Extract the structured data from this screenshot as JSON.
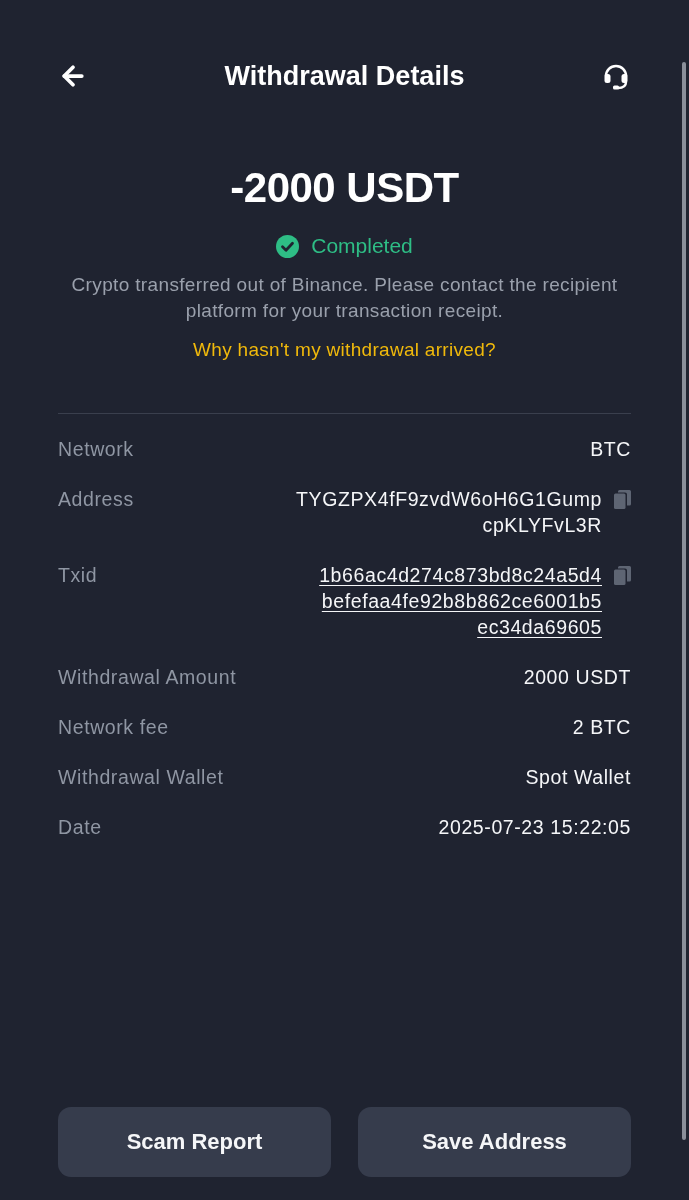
{
  "header": {
    "title": "Withdrawal Details"
  },
  "summary": {
    "amount": "-2000 USDT",
    "status": {
      "label": "Completed",
      "kind": "completed"
    },
    "description": "Crypto transferred out of Binance. Please contact the recipient platform for your transaction receipt.",
    "help_link": "Why hasn't my withdrawal arrived?"
  },
  "details": [
    {
      "label": "Network",
      "value": "BTC",
      "kind": "text"
    },
    {
      "label": "Address",
      "value": "TYGZPX4fF9zvdW6oH6G1GumpcpKLYFvL3R",
      "kind": "copy"
    },
    {
      "label": "Txid",
      "value": "1b66ac4d274c873bd8c24a5d4befefaa4fe92b8b862ce6001b5ec34da69605",
      "kind": "link"
    },
    {
      "label": "Withdrawal Amount",
      "value": "2000 USDT",
      "kind": "text"
    },
    {
      "label": "Network fee",
      "value": "2 BTC",
      "kind": "text"
    },
    {
      "label": "Withdrawal Wallet",
      "value": "Spot Wallet",
      "kind": "text"
    },
    {
      "label": "Date",
      "value": "2025-07-23 15:22:05",
      "kind": "text"
    }
  ],
  "buttons": [
    "Scam Report",
    "Save Address"
  ]
}
